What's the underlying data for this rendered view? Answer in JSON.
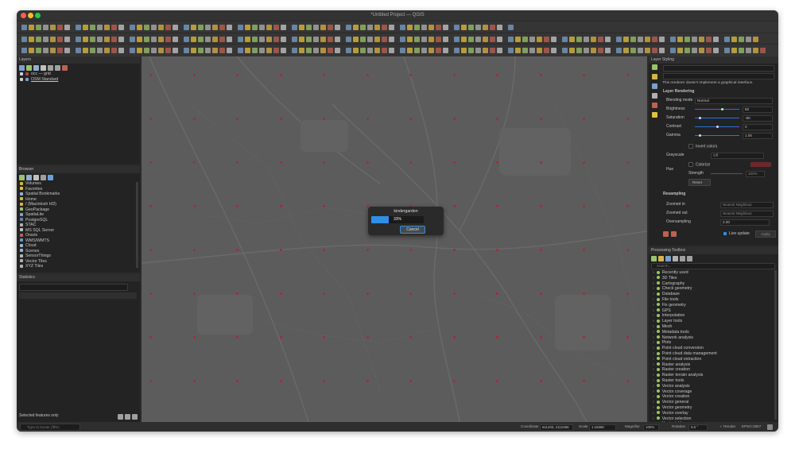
{
  "window": {
    "title": "*Untitled Project — QGIS"
  },
  "layers_panel": {
    "title": "Layers",
    "items": [
      {
        "name": "occ — grid",
        "color": "#c94040"
      },
      {
        "name": "OSM Standard",
        "color": "#6aa0d8"
      }
    ]
  },
  "browser_panel": {
    "title": "Browser",
    "items": [
      {
        "label": "Volumes",
        "icon": "folder-icon",
        "color": "#d8b24a"
      },
      {
        "label": "Favorites",
        "icon": "star-icon",
        "color": "#e0c040"
      },
      {
        "label": "Spatial Bookmarks",
        "icon": "bookmark-icon",
        "color": "#8fb0d0"
      },
      {
        "label": "Home",
        "icon": "folder-icon",
        "color": "#d8b24a"
      },
      {
        "label": "/ (Macintosh HD)",
        "icon": "folder-icon",
        "color": "#d8b24a"
      },
      {
        "label": "GeoPackage",
        "icon": "geopackage-icon",
        "color": "#9bc36a"
      },
      {
        "label": "SpatiaLite",
        "icon": "spatialite-icon",
        "color": "#7fa4c8"
      },
      {
        "label": "PostgreSQL",
        "icon": "postgresql-icon",
        "color": "#5a86b8"
      },
      {
        "label": "STAC",
        "icon": "stac-icon",
        "color": "#b0b0b0"
      },
      {
        "label": "MS SQL Server",
        "icon": "mssql-icon",
        "color": "#c0c0c0"
      },
      {
        "label": "Oracle",
        "icon": "oracle-icon",
        "color": "#c06050"
      },
      {
        "label": "WMS/WMTS",
        "icon": "globe-icon",
        "color": "#5b9bd5"
      },
      {
        "label": "Cloud",
        "icon": "cloud-icon",
        "color": "#9ab4d4"
      },
      {
        "label": "Scenes",
        "icon": "scenes-icon",
        "color": "#9ab4d4"
      },
      {
        "label": "SensorThings",
        "icon": "sensor-icon",
        "color": "#a0c0a0"
      },
      {
        "label": "Vector Tiles",
        "icon": "vector-tiles-icon",
        "color": "#b0b0b0"
      },
      {
        "label": "XYZ Tiles",
        "icon": "xyz-tiles-icon",
        "color": "#b0b0b0"
      }
    ]
  },
  "statistics_panel": {
    "title": "Statistics"
  },
  "left_footer": {
    "label": "Selected features only"
  },
  "locator": {
    "placeholder": "Type to locate (⌘K)"
  },
  "progress_dialog": {
    "title": "kindergarden",
    "percent_text": "33%",
    "progress": 0.33,
    "cancel_label": "Cancel"
  },
  "layer_styling": {
    "title": "Layer Styling",
    "renderer_note": "This renderer doesn't implement a graphical interface.",
    "section_title": "Layer Rendering",
    "fields": [
      {
        "label": "Blending mode",
        "value": "Normal"
      },
      {
        "label": "Brightness",
        "value": "50",
        "slider": 0.6
      },
      {
        "label": "Saturation",
        "value": "-80",
        "slider": 0.1
      },
      {
        "label": "Contrast",
        "value": "0",
        "slider": 0.5
      },
      {
        "label": "Gamma",
        "value": "1.00",
        "slider": 0.1
      }
    ],
    "invert_label": "Invert colors",
    "grayscale_label": "Grayscale",
    "grayscale_value": "Off",
    "hue_label": "Hue",
    "colorize_label": "Colorize",
    "strength_label": "Strength",
    "strength_value": "100%",
    "reset_label": "Reset",
    "resampling_title": "Resampling",
    "zoomed_in_label": "Zoomed in",
    "zoomed_in_value": "Nearest Neighbour",
    "zoomed_out_label": "Zoomed out",
    "zoomed_out_value": "Nearest Neighbour",
    "oversampling_label": "Oversampling",
    "oversampling_value": "2.00",
    "live_update_label": "Live update",
    "apply_label": "Apply"
  },
  "processing_toolbox": {
    "title": "Processing Toolbox",
    "search_placeholder": "Search...",
    "items": [
      "Recently used",
      "3D Tiles",
      "Cartography",
      "Check geometry",
      "Database",
      "File tools",
      "Fix geometry",
      "GPS",
      "Interpolation",
      "Layer tools",
      "Mesh",
      "Metadata tools",
      "Network analysis",
      "Plots",
      "Point cloud conversion",
      "Point cloud data management",
      "Point cloud extraction",
      "Raster analysis",
      "Raster creation",
      "Raster terrain analysis",
      "Raster tools",
      "Vector analysis",
      "Vector coverage",
      "Vector creation",
      "Vector general",
      "Vector geometry",
      "Vector overlay",
      "Vector selection",
      "Vector table",
      "Vector tiles"
    ]
  },
  "status": {
    "coordinate_label": "Coordinate",
    "coordinate_value": "611203, 2112496",
    "scale_label": "Scale",
    "scale_value": "1:18360",
    "magnifier_label": "Magnifier",
    "magnifier_value": "100%",
    "rotation_label": "Rotation",
    "rotation_value": "0.0 °",
    "render_label": "Render",
    "crs_value": "EPSG:3857"
  },
  "colors": {
    "accent": "#2f8fe8",
    "panel_bg": "#232323",
    "map_bg": "#5c5c5c",
    "grid_point": "#a02d3a"
  }
}
